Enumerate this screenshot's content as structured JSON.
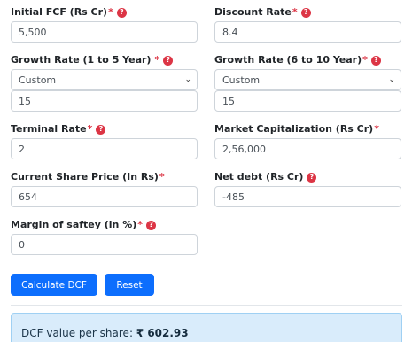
{
  "required_mark": "*",
  "help_glyph": "?",
  "colors": {
    "primary": "#0d6efd",
    "required": "#dc3545",
    "result_bg": "#d9ecfb"
  },
  "fields": {
    "initial_fcf": {
      "label": "Initial FCF (Rs Cr)",
      "value": "5,500"
    },
    "discount_rate": {
      "label": "Discount Rate",
      "value": "8.4"
    },
    "growth_1_5": {
      "label": "Growth Rate (1 to 5 Year)",
      "select": "Custom",
      "value": "15"
    },
    "growth_6_10": {
      "label": "Growth Rate (6 to 10 Year)",
      "select": "Custom",
      "value": "15"
    },
    "terminal_rate": {
      "label": "Terminal Rate",
      "value": "2"
    },
    "market_cap": {
      "label": "Market Capitalization (Rs Cr)",
      "value": "2,56,000"
    },
    "share_price": {
      "label": "Current Share Price (In Rs)",
      "value": "654"
    },
    "net_debt": {
      "label": "Net debt (Rs Cr)",
      "value": "-485"
    },
    "margin_safety": {
      "label": "Margin of saftey (in %)",
      "value": "0"
    }
  },
  "buttons": {
    "calculate": "Calculate DCF",
    "reset": "Reset"
  },
  "result": {
    "label": "DCF value per share:",
    "value": "₹ 602.93"
  }
}
